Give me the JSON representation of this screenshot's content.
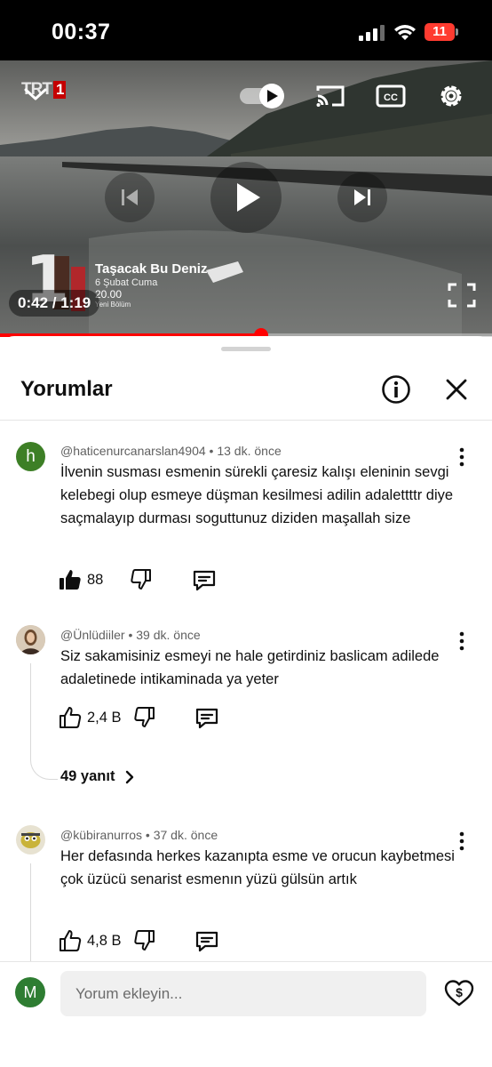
{
  "status_bar": {
    "time": "00:37",
    "battery": "11"
  },
  "video": {
    "channel_logo": "TRT",
    "channel_logo_number": "1",
    "promo": {
      "episode_number": "1",
      "title": "Taşacak Bu Deniz",
      "date": "6 Şubat Cuma",
      "time": "20.00",
      "note": "Yeni Bölüm"
    },
    "current_time": "0:42",
    "duration": "1:19",
    "time_separator": " / ",
    "progress_fraction": 0.53,
    "icons": [
      "chevron-down-icon",
      "autoplay-toggle-icon",
      "cast-icon",
      "cc-icon",
      "gear-icon",
      "previous-icon",
      "play-icon",
      "next-icon",
      "fullscreen-icon"
    ]
  },
  "comments_panel": {
    "title": "Yorumlar",
    "comments": [
      {
        "avatar_letter": "h",
        "author": "@haticenurcanarslan4904",
        "age": "13 dk. önce",
        "text": "İlvenin susması esmenin sürekli çaresiz kalışı eleninin sevgi kelebegi olup esmeye düşman kesilmesi adilin adalettttr diye saçmalayıp durması soguttunuz diziden maşallah size",
        "likes": "88",
        "liked": true
      },
      {
        "author": "@Ünlüdiiler",
        "age": "39 dk. önce",
        "text": "Siz sakamisiniz esmeyi ne hale getirdiniz baslicam adilede adaletinede intikaminada ya yeter",
        "likes": "2,4 B",
        "liked": false,
        "replies": "49 yanıt"
      },
      {
        "author": "@kübiranurros",
        "age": "37 dk. önce",
        "text": "Her defasında herkes kazanıpta esme ve orucun kaybetmesi çok üzücü senarist esmenın yüzü gülsün artık",
        "likes": "4,8 B",
        "liked": false
      }
    ]
  },
  "comment_box": {
    "avatar_letter": "M",
    "placeholder": "Yorum ekleyin..."
  },
  "colors": {
    "accent": "#ff0000",
    "text": "#0f0f0f",
    "secondary_text": "#606060",
    "avatar_h": "#3d7f26",
    "avatar_m": "#2e7d32",
    "battery": "#ff3b30"
  }
}
